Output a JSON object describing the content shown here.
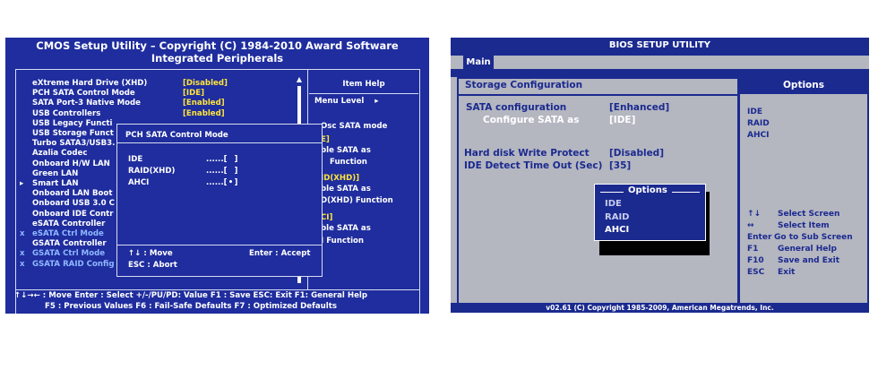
{
  "award": {
    "title_line1": "CMOS Setup Utility – Copyright (C) 1984-2010 Award Software",
    "title_line2": "Integrated Peripherals",
    "items": [
      {
        "label": "eXtreme Hard Drive (XHD)",
        "value": "[Disabled]"
      },
      {
        "label": "PCH SATA Control Mode",
        "value": "[IDE]"
      },
      {
        "label": "SATA Port-3 Native Mode",
        "value": "[Enabled]"
      },
      {
        "label": "USB Controllers",
        "value": "[Enabled]"
      },
      {
        "label": "USB Legacy Functi"
      },
      {
        "label": "USB Storage Funct"
      },
      {
        "label": "Turbo SATA3/USB3."
      },
      {
        "label": "Azalia Codec"
      },
      {
        "label": "Onboard H/W LAN"
      },
      {
        "label": "Green LAN"
      },
      {
        "label": "Smart LAN",
        "marker": "▸"
      },
      {
        "label": "Onboard LAN Boot"
      },
      {
        "label": "Onboard USB 3.0 C"
      },
      {
        "label": "Onboard IDE Contr"
      },
      {
        "label": "eSATA Controller"
      },
      {
        "label": "eSATA Ctrl Mode",
        "marker": "x"
      },
      {
        "label": "GSATA Controller"
      },
      {
        "label": "GSATA Ctrl Mode",
        "marker": "x"
      },
      {
        "label": "GSATA RAID Config",
        "marker": "x"
      }
    ],
    "item_help": {
      "title": "Item Help",
      "menu_level": "Menu Level",
      "menu_arrow": "▸",
      "lines": [
        {
          "text": "Osc SATA mode",
          "color": "white"
        },
        {
          "text": "E]",
          "color": "yellow"
        },
        {
          "text": "ble SATA as",
          "color": "white"
        },
        {
          "text": "Function",
          "color": "white"
        },
        {
          "text": "ID(XHD)]",
          "color": "yellow"
        },
        {
          "text": "ble SATA as",
          "color": "white"
        },
        {
          "text": "D(XHD) Function",
          "color": "white"
        },
        {
          "text": "CI]",
          "color": "yellow"
        },
        {
          "text": "ble SATA as",
          "color": "white"
        },
        {
          "text": "I Function",
          "color": "white"
        }
      ]
    },
    "popup": {
      "title": "PCH SATA Control Mode",
      "options": [
        {
          "label": "IDE",
          "dots": "......[",
          "mark": "",
          "close": "]"
        },
        {
          "label": "RAID(XHD)",
          "dots": "......[",
          "mark": "",
          "close": "]"
        },
        {
          "label": "AHCI",
          "dots": "......[",
          "mark": "•",
          "close": "]"
        }
      ],
      "move": "↑↓ : Move",
      "accept": "Enter : Accept",
      "abort": "ESC  : Abort"
    },
    "footer_line1": "↑↓→← : Move   Enter : Select   +/-/PU/PD: Value   F1 : Save   ESC: Exit   F1: General Help",
    "footer_line2": "F5 : Previous Values     F6 : Fail-Safe Defaults       F7 : Optimized Defaults",
    "colors": {
      "background": "#1f2d9e",
      "value": "#ffe53a",
      "selected": "#e8222b",
      "disabled_item": "#8fb8ff"
    }
  },
  "ami": {
    "title": "BIOS SETUP UTILITY",
    "tab": "Main",
    "section_title": "Storage Configuration",
    "settings": [
      {
        "label": "SATA configuration",
        "value": "[Enhanced]"
      },
      {
        "label": "Configure SATA as",
        "value": "[IDE]"
      },
      {
        "label": "Hard disk Write Protect",
        "value": "[Disabled]"
      },
      {
        "label": "IDE Detect Time Out (Sec)",
        "value": "[35]"
      }
    ],
    "options_popup": {
      "title": "Options",
      "items": [
        "IDE",
        "RAID",
        "AHCI"
      ]
    },
    "options_panel": {
      "title": "Options",
      "items": [
        "IDE",
        "RAID",
        "AHCI"
      ]
    },
    "keys": [
      {
        "key": "↑↓",
        "desc": "Select Screen"
      },
      {
        "key": "↔",
        "desc": "Select Item"
      },
      {
        "key": "Enter",
        "desc": "Go to Sub Screen"
      },
      {
        "key": "F1",
        "desc": "General Help"
      },
      {
        "key": "F10",
        "desc": "Save and Exit"
      },
      {
        "key": "ESC",
        "desc": "Exit"
      }
    ],
    "footer": "v02.61  (C) Copyright  1985-2009,  American Megatrends,  Inc.",
    "colors": {
      "background": "#b4b6c0",
      "text": "#1b2a8f"
    }
  }
}
